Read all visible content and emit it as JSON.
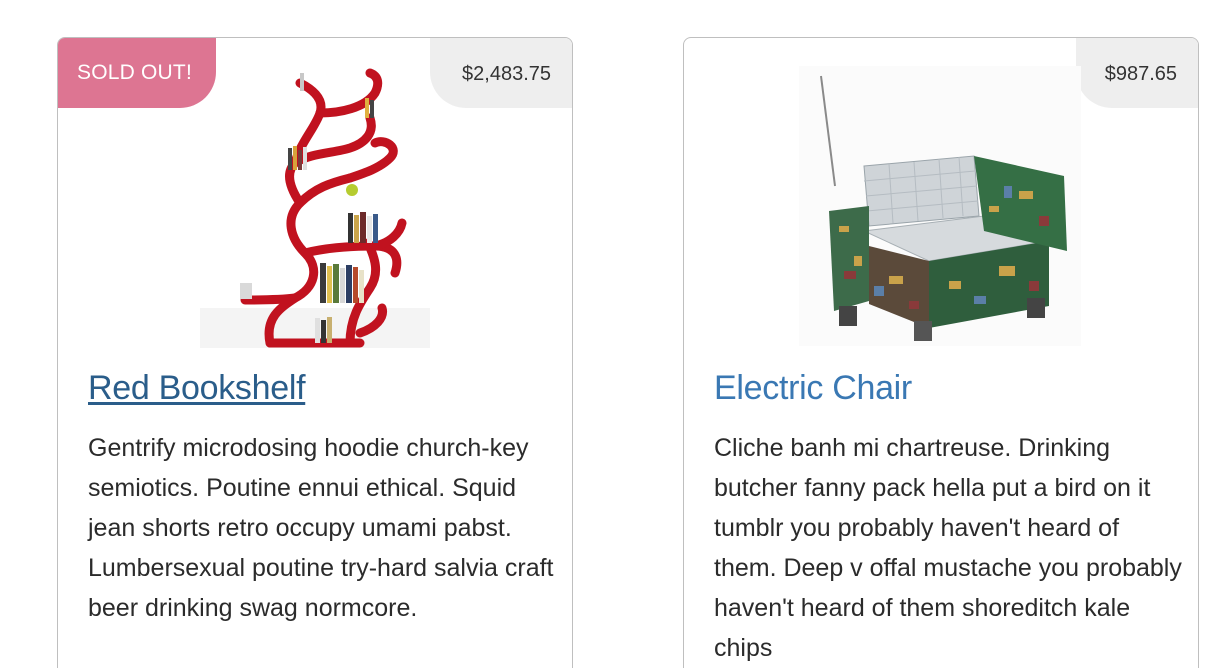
{
  "products": [
    {
      "badge": "SOLD OUT!",
      "price": "$2,483.75",
      "image_icon": "red-bookshelf-image",
      "title": "Red Bookshelf",
      "description": "Gentrify microdosing hoodie church-key semiotics. Poutine ennui ethical. Squid jean shorts retro occupy umami pabst. Lumbersexual poutine try-hard salvia craft beer drinking swag normcore."
    },
    {
      "price": "$987.65",
      "image_icon": "electric-chair-image",
      "title": "Electric Chair",
      "description": "Cliche banh mi chartreuse. Drinking butcher fanny pack hella put a bird on it tumblr you probably haven't heard of them. Deep v offal mustache you probably haven't heard of them shoreditch kale chips"
    }
  ],
  "colors": {
    "sold_badge": "#dd7592",
    "price_badge": "#eeeeee",
    "link_visited": "#2a5d8a",
    "link": "#3a78b3"
  }
}
